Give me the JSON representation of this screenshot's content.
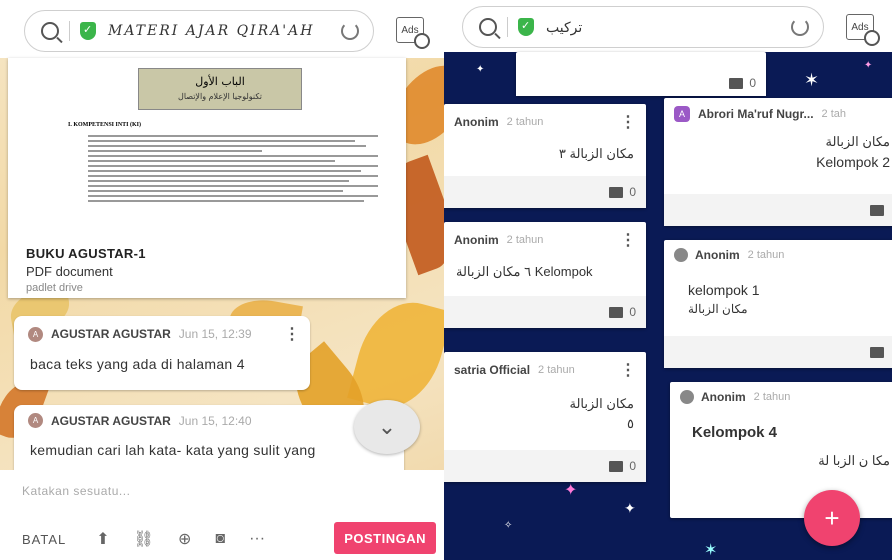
{
  "left": {
    "address": {
      "title": "MATERI AJAR QIRA'AH"
    },
    "ads_label": "Ads",
    "document": {
      "banner_line1": "الباب الأول",
      "banner_line2": "تكنولوجيا الإعلام والإتصال",
      "section_heading": "I.    KOMPETENSI INTI (KI)",
      "title": "BUKU AGUSTAR-1",
      "type": "PDF document",
      "source": "padlet drive"
    },
    "comments": [
      {
        "avatar": "A",
        "author": "AGUSTAR AGUSTAR",
        "time": "Jun 15, 12:39",
        "text": "baca  teks yang ada di halaman 4"
      },
      {
        "avatar": "A",
        "author": "AGUSTAR AGUSTAR",
        "time": "Jun 15, 12:40",
        "text": "kemudian cari lah kata- kata yang sulit yang"
      }
    ],
    "composer": {
      "placeholder": "Katakan sesuatu...",
      "cancel": "BATAL",
      "post": "POSTINGAN"
    },
    "icons": [
      "upload-icon",
      "link-icon",
      "search-web-icon",
      "camera-icon",
      "more-icon"
    ]
  },
  "right": {
    "address": {
      "title": "تركيب"
    },
    "ads_label": "Ads",
    "top_count": "0",
    "cards": [
      {
        "author": "Anonim",
        "time": "2 tahun",
        "line1": "مكان الزبالة    ٣",
        "line2": "",
        "count": "0"
      },
      {
        "author": "Anonim",
        "time": "2 tahun",
        "line1": "٦ مكان الزبالة  Kelompok",
        "line2": "",
        "count": "0"
      },
      {
        "author": "satria Official",
        "time": "2 tahun",
        "line1": "مكان الزبالة",
        "line2": "٥",
        "count": "0"
      },
      {
        "avatar": "A",
        "author": "Abrori Ma'ruf Nugr...",
        "time": "2 tah",
        "line1": "مكان الزبالة",
        "line2": "Kelompok 2",
        "count": ""
      },
      {
        "author": "Anonim",
        "time": "2 tahun",
        "line1": "kelompok 1",
        "line2": "مكان الزبالة",
        "count": ""
      },
      {
        "author": "Anonim",
        "time": "2 tahun",
        "line1": "Kelompok 4",
        "line2": "مكا ن الزبا لة",
        "count": ""
      }
    ],
    "fab": "+"
  }
}
